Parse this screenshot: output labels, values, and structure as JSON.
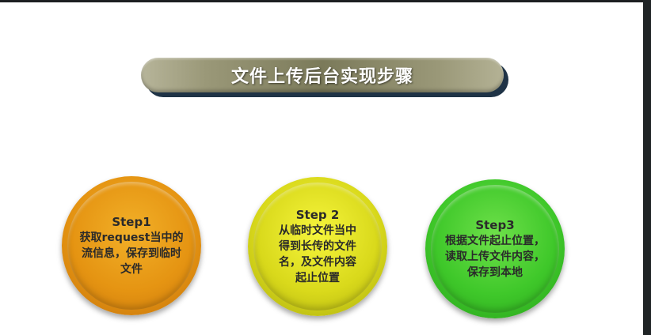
{
  "slide": {
    "title": "文件上传后台实现步骤",
    "steps": [
      {
        "title": "Step1",
        "body": "获取request当中的\n流信息，保存到临时\n文件",
        "color": "#e59412"
      },
      {
        "title": "Step 2",
        "body": "从临时文件当中\n得到长传的文件\n名，及文件内容\n起止位置",
        "color": "#d9d91b"
      },
      {
        "title": "Step3",
        "body": "根据文件起止位置，\n读取上传文件内容，\n保存到本地",
        "color": "#3fc82a"
      }
    ]
  },
  "colors": {
    "title_pill": "#8a8868",
    "title_shadow": "#1f3346",
    "slide_background": "#ffffff"
  }
}
